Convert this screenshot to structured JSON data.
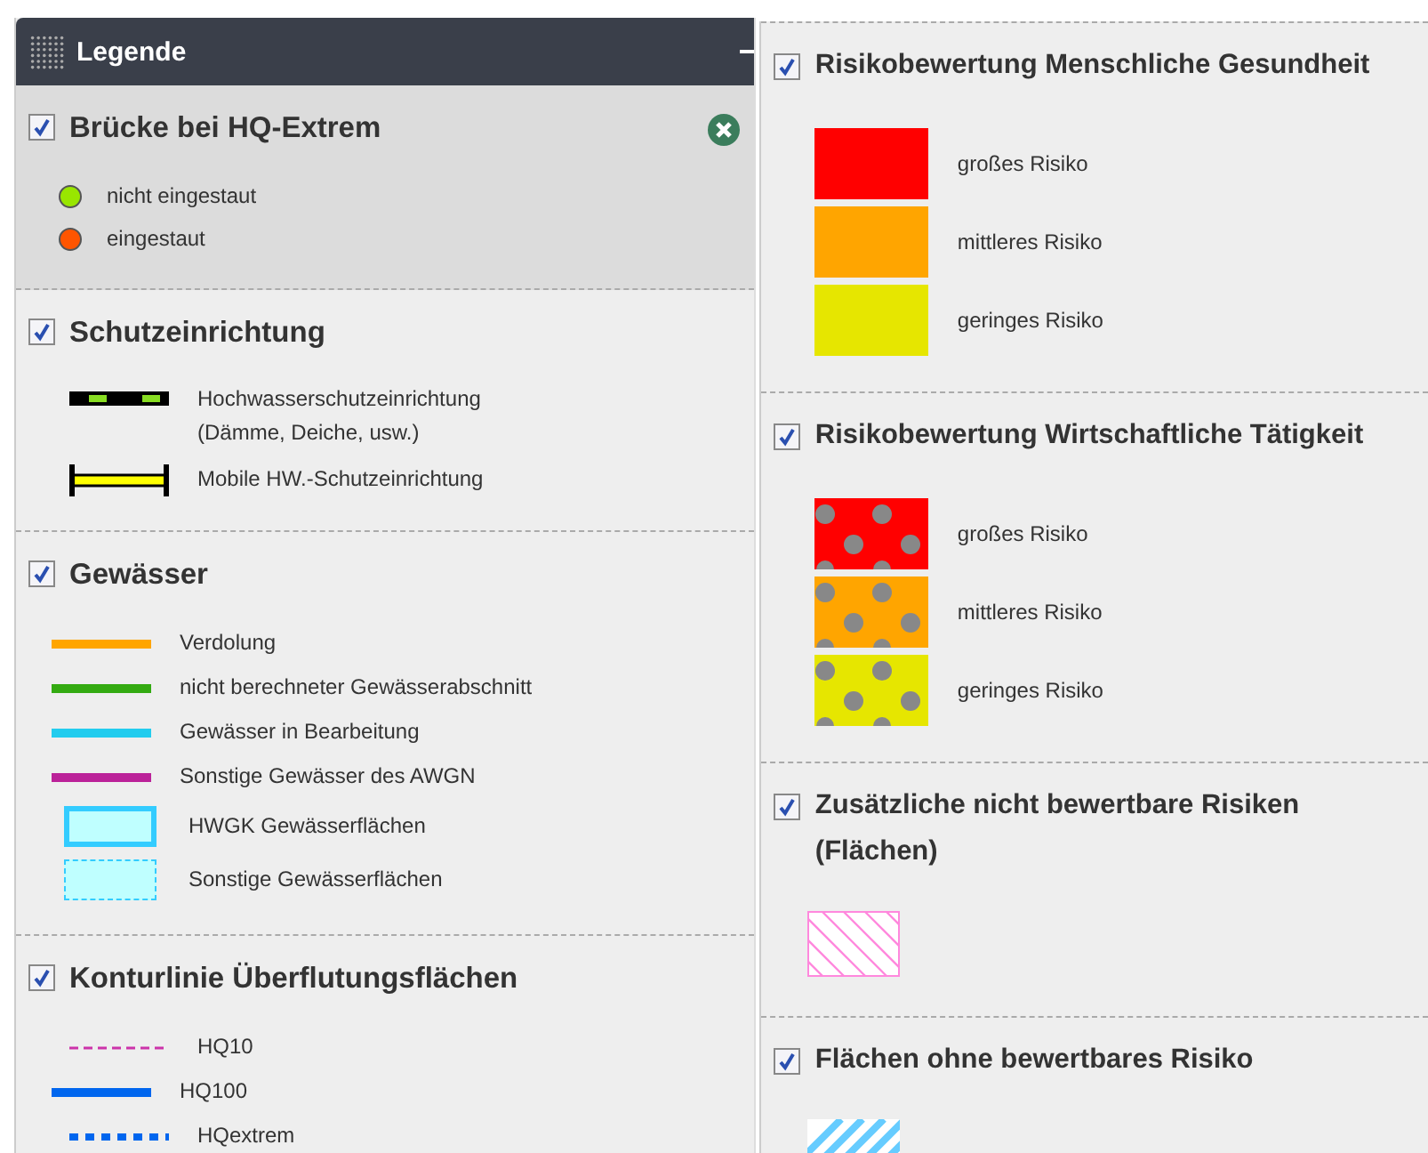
{
  "panel": {
    "title": "Legende"
  },
  "columns": [
    {
      "sections": [
        {
          "title": "Brücke bei HQ-Extrem",
          "checked": true,
          "selected": true,
          "items": [
            {
              "kind": "dot",
              "label": "nicht eingestaut",
              "color": "#99e600"
            },
            {
              "kind": "dot",
              "label": "eingestaut",
              "color": "#ff5500"
            }
          ]
        },
        {
          "title": "Schutzeinrichtung",
          "checked": true,
          "selected": false,
          "items": [
            {
              "kind": "dike",
              "label": "Hochwasserschutzeinrichtung\n(Dämme, Deiche, usw.)",
              "color": "#88dd22"
            },
            {
              "kind": "mobile",
              "label": "Mobile HW.-Schutzeinrichtung",
              "color": "#ffff00"
            }
          ]
        },
        {
          "title": "Gewässer",
          "checked": true,
          "selected": false,
          "items": [
            {
              "kind": "line",
              "label": "Verdolung",
              "color": "#ffa500"
            },
            {
              "kind": "line",
              "label": "nicht berechneter Gewässerabschnitt",
              "color": "#33aa11"
            },
            {
              "kind": "line",
              "label": "Gewässer in Bearbeitung",
              "color": "#22ccee"
            },
            {
              "kind": "line",
              "label": "Sonstige Gewässer des AWGN",
              "color": "#bb2299"
            },
            {
              "kind": "area",
              "label": "HWGK Gewässerflächen",
              "color": "#33ccff"
            },
            {
              "kind": "area-dashed",
              "label": "Sonstige Gewässerflächen",
              "color": "#33ccff"
            }
          ]
        },
        {
          "title": "Konturlinie Überflutungsflächen",
          "checked": true,
          "selected": false,
          "items": [
            {
              "kind": "dashed",
              "label": "HQ10",
              "color": "#cc33aa"
            },
            {
              "kind": "line",
              "label": "HQ100",
              "color": "#0066ee"
            },
            {
              "kind": "dotted",
              "label": "HQextrem",
              "color": "#0066ee"
            }
          ]
        }
      ]
    },
    {
      "sections": [
        {
          "title": "Risikobewertung Menschliche Gesundheit",
          "checked": true,
          "selected": false,
          "items": [
            {
              "kind": "swatch",
              "label": "großes Risiko",
              "color": "#ff0000"
            },
            {
              "kind": "swatch",
              "label": "mittleres Risiko",
              "color": "#ffa500"
            },
            {
              "kind": "swatch",
              "label": "geringes Risiko",
              "color": "#e6e600"
            }
          ]
        },
        {
          "title": "Risikobewertung Wirtschaftliche Tätigkeit",
          "checked": true,
          "selected": false,
          "items": [
            {
              "kind": "dotted-swatch",
              "label": "großes Risiko",
              "color": "#ff0000"
            },
            {
              "kind": "dotted-swatch",
              "label": "mittleres Risiko",
              "color": "#ffa500"
            },
            {
              "kind": "dotted-swatch",
              "label": "geringes Risiko",
              "color": "#e6e600"
            }
          ]
        },
        {
          "title": "Zusätzliche nicht bewertbare Risiken (Flächen)",
          "checked": true,
          "selected": false,
          "items": [
            {
              "kind": "hatch-pink",
              "color": "#ff88dd"
            }
          ]
        },
        {
          "title": "Flächen ohne bewertbares Risiko",
          "checked": true,
          "selected": false,
          "items": [
            {
              "kind": "hatch-blue",
              "color": "#66ccff"
            }
          ]
        }
      ]
    }
  ]
}
